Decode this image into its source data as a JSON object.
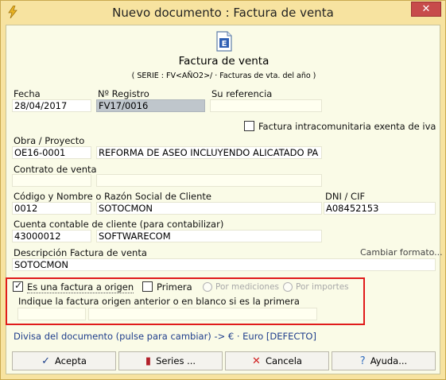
{
  "window": {
    "title": "Nuevo documento : Factura de venta"
  },
  "header": {
    "title": "Factura de venta",
    "subtitle": "( SERIE : FV<AÑO2>/ · Facturas  de vta. del año )"
  },
  "fecha": {
    "label": "Fecha",
    "value": "28/04/2017"
  },
  "registro": {
    "label": "Nº Registro",
    "value": "FV17/0016"
  },
  "referencia": {
    "label": "Su referencia",
    "value": ""
  },
  "intracomunitaria": {
    "label": "Factura intracomunitaria exenta de iva",
    "checked": false
  },
  "obra": {
    "label": "Obra / Proyecto",
    "code": "OE16-0001",
    "name": "REFORMA DE ASEO INCLUYENDO ALICATADO PA"
  },
  "contrato": {
    "label": "Contrato de venta",
    "code": "",
    "name": ""
  },
  "cliente": {
    "label": "Código y Nombre o Razón Social de Cliente",
    "code": "0012",
    "name": "SOTOCMON"
  },
  "dni": {
    "label": "DNI / CIF",
    "value": "A08452153"
  },
  "cuenta": {
    "label": "Cuenta contable de cliente (para contabilizar)",
    "code": "43000012",
    "name": "SOFTWARECOM"
  },
  "descripcion": {
    "label": "Descripción Factura de venta",
    "value": "SOTOCMON",
    "format_link": "Cambiar formato..."
  },
  "origen": {
    "checkbox_label": "Es una factura a origen",
    "checked": true,
    "primera_label": "Primera",
    "por_mediciones": "Por mediciones",
    "por_importes": "Por importes",
    "hint": "Indique la factura origen anterior o en blanco si es la primera",
    "code": "",
    "name": ""
  },
  "divisa": "Divisa del documento (pulse para cambiar) -> € · Euro [DEFECTO]",
  "buttons": {
    "accept": "Acepta",
    "series": "Series ...",
    "cancel": "Cancela",
    "help": "Ayuda..."
  },
  "colors": {
    "window_bg": "#f7e3a0",
    "client_bg": "#fafbe7",
    "highlight_border": "#e01b1b",
    "link_blue": "#1f3e8c"
  }
}
